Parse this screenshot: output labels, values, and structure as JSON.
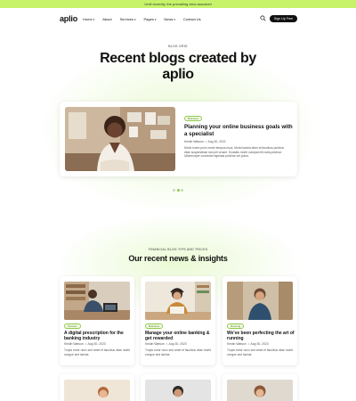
{
  "announcement": "Until recently, the prevailing view assumed",
  "nav": {
    "logo": "aplio",
    "items": [
      "Home",
      "About",
      "Services",
      "Pages",
      "News",
      "Contact Us"
    ],
    "signup_label": "Sign Up Free"
  },
  "hero": {
    "eyebrow": "BLOG GRID",
    "title": "Recent blogs created by aplio"
  },
  "featured": {
    "tag": "Business",
    "title": "Planning your online business goals with a specialist",
    "author": "Kristin Watson",
    "date": "Aug 30, 2022",
    "description": "Morbi lorem proin morbi tempus risus. Morbi lacinia diam at faucibus pulvinar vitae suspendisse sed pel ornare. Sodales morbi volutpat elit nulla pulvinar. Ullamcorper consectet egestas pulvinar vel purus."
  },
  "slider": {
    "count": 3,
    "active": 1
  },
  "news": {
    "eyebrow": "FINANCIAL BLOG TIPS AND TRICKS",
    "title": "Our recent news & insights",
    "cards": [
      {
        "tag": "Finance",
        "title": "A digital prescription for the banking industry",
        "author": "Kristin Watson",
        "date": "Aug 30, 2023",
        "description": "Turpis tortor nunc sed amet et faucibus vitae morbi congue sed lacinia."
      },
      {
        "tag": "Business",
        "title": "Manage your online banking & get rewarded",
        "author": "Kristin Watson",
        "date": "Aug 30, 2023",
        "description": "Turpis tortor nunc sed amet et faucibus vitae morbi congue sed lacinia."
      },
      {
        "tag": "Running",
        "title": "We've been perfecting the art of running",
        "author": "Kristin Watson",
        "date": "Aug 30, 2023",
        "description": "Turpis tortor nunc sed amet et faucibus vitae morbi congue sed lacinia."
      }
    ]
  },
  "colors": {
    "accent": "#c6f36a",
    "tag_border": "#8fc84a",
    "button": "#111111"
  }
}
